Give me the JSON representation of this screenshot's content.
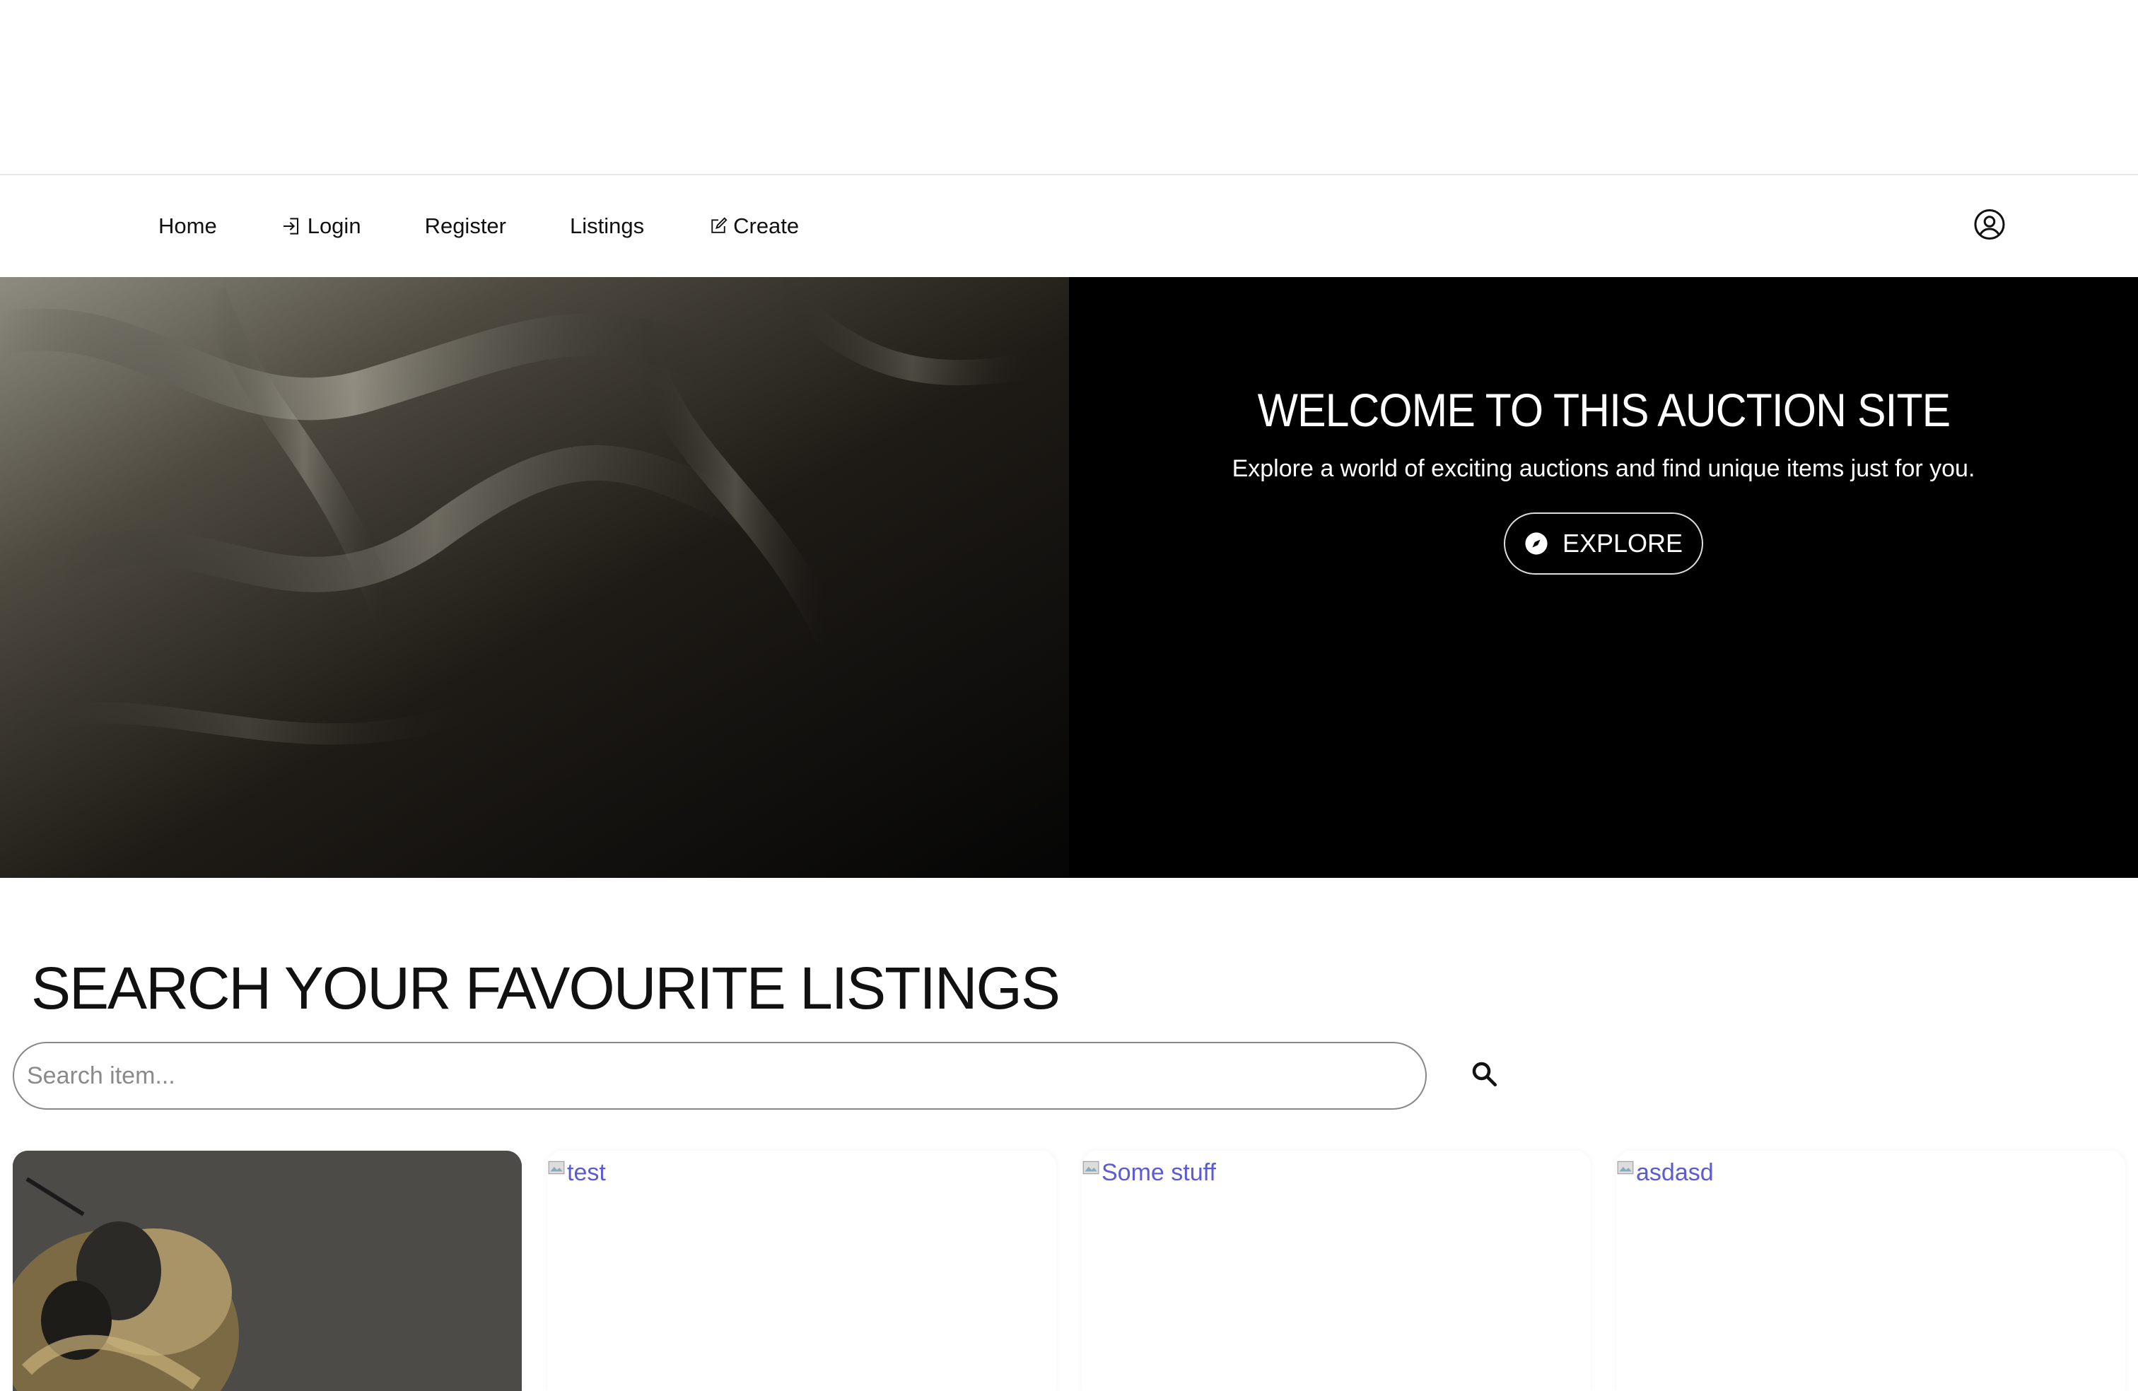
{
  "nav": {
    "items": [
      {
        "label": "Home",
        "icon": ""
      },
      {
        "label": "Login",
        "icon": "login-icon"
      },
      {
        "label": "Register",
        "icon": ""
      },
      {
        "label": "Listings",
        "icon": ""
      },
      {
        "label": "Create",
        "icon": "edit-icon"
      }
    ],
    "profile_icon": "user-circle-icon"
  },
  "hero": {
    "title": "WELCOME TO THIS AUCTION SITE",
    "subtitle": "Explore a world of exciting auctions and find unique items just for you.",
    "button_label": "EXPLORE",
    "button_icon": "compass-icon"
  },
  "search": {
    "title": "SEARCH YOUR FAVOURITE LISTINGS",
    "placeholder": "Search item...",
    "value": "",
    "button_icon": "search-icon"
  },
  "listings": [
    {
      "alt": "",
      "image": "bee-photo"
    },
    {
      "alt": "test",
      "image": "broken-image"
    },
    {
      "alt": "Some stuff",
      "image": "broken-image"
    },
    {
      "alt": "asdasd",
      "image": "broken-image"
    }
  ],
  "colors": {
    "hero_bg": "#000000",
    "link_alt": "#5b5bd6",
    "border": "#888888"
  }
}
